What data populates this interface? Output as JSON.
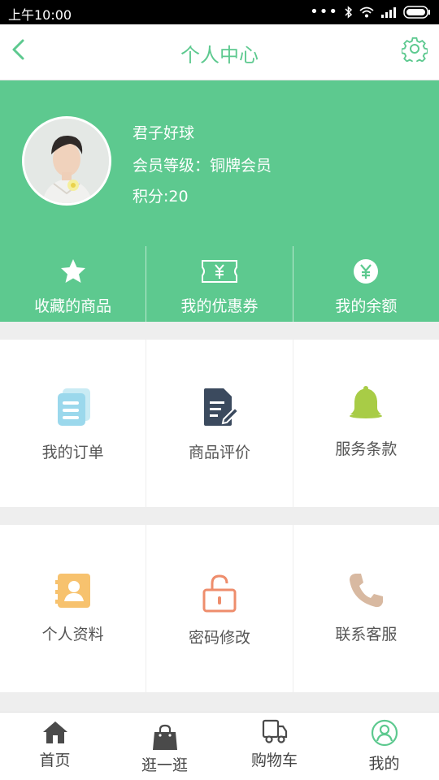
{
  "status_bar": {
    "time": "上午10:00"
  },
  "nav": {
    "title": "个人中心"
  },
  "profile": {
    "username": "君子好球",
    "member_level": "会员等级：铜牌会员",
    "points": "积分:20"
  },
  "quick_actions": [
    {
      "label": "收藏的商品",
      "icon": "star-icon"
    },
    {
      "label": "我的优惠券",
      "icon": "coupon-icon"
    },
    {
      "label": "我的余额",
      "icon": "yuan-coin-icon"
    }
  ],
  "menu_row1": [
    {
      "label": "我的订单",
      "icon": "orders-icon"
    },
    {
      "label": "商品评价",
      "icon": "review-edit-icon"
    },
    {
      "label": "服务条款",
      "icon": "bell-icon"
    }
  ],
  "menu_row2": [
    {
      "label": "个人资料",
      "icon": "contact-card-icon"
    },
    {
      "label": "密码修改",
      "icon": "unlock-icon"
    },
    {
      "label": "联系客服",
      "icon": "phone-icon"
    }
  ],
  "tabs": [
    {
      "label": "首页",
      "icon": "home-icon",
      "active": false
    },
    {
      "label": "逛一逛",
      "icon": "shopping-bag-icon",
      "active": false
    },
    {
      "label": "购物车",
      "icon": "cart-truck-icon",
      "active": false
    },
    {
      "label": "我的",
      "icon": "user-circle-icon",
      "active": true
    }
  ],
  "colors": {
    "accent": "#5dc98f",
    "background": "#eeeeee",
    "text": "#555555"
  }
}
